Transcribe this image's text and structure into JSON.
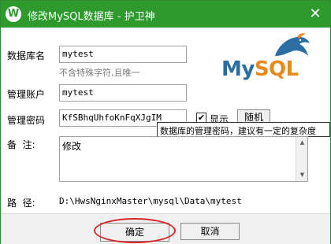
{
  "window": {
    "title": "修改MySQL数据库 - 护卫神",
    "icon_glyph": "W",
    "close_glyph": "✕"
  },
  "logo": {
    "part1": "My",
    "part2": "SQL"
  },
  "form": {
    "db_name": {
      "label": "数据库名",
      "value": "mytest",
      "hint": "不含特殊字符,且唯一"
    },
    "account": {
      "label": "管理账户",
      "value": "mytest"
    },
    "password": {
      "label": "管理密码",
      "value": "KfSBhqUhfoKnFqXJgIM",
      "show_label": "显示",
      "show_checked": true,
      "check_glyph": "✔",
      "random_label": "随机",
      "tooltip": "数据库的管理密码，建议有一定的复杂度"
    },
    "remark": {
      "label": "备  注:",
      "value": "修改"
    },
    "path": {
      "label": "路  径:",
      "value": "D:\\HwsNginxMaster\\mysql\\Data\\mytest"
    }
  },
  "buttons": {
    "ok": "确定",
    "cancel": "取消"
  },
  "colors": {
    "titlebar": "#2e9a2e",
    "annotation": "#d62828",
    "mysql_blue": "#2c6ea3",
    "mysql_orange": "#e48a1e"
  }
}
